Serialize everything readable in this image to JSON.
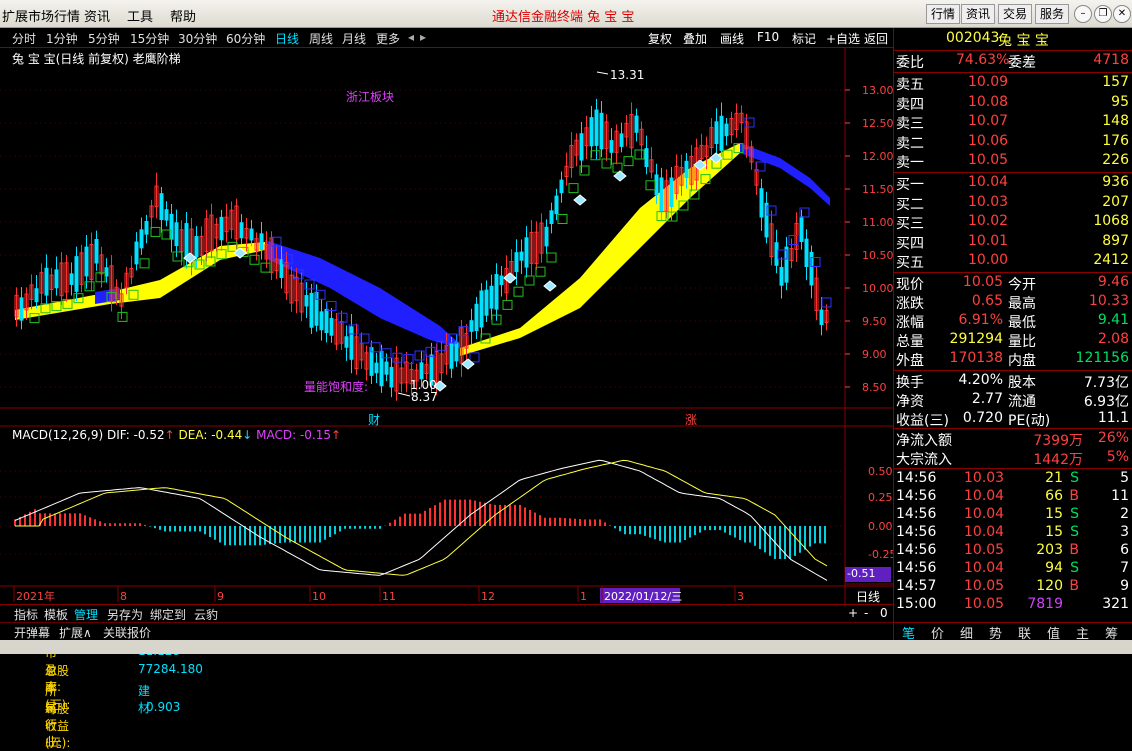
{
  "menu": {
    "items": [
      "扩展市场行情",
      "资讯",
      "工具",
      "帮助"
    ],
    "app_title": "通达信金融终端  兔 宝 宝",
    "right_buttons": [
      "行情",
      "资讯",
      "交易",
      "服务"
    ]
  },
  "timeframes": [
    "分时",
    "1分钟",
    "5分钟",
    "15分钟",
    "30分钟",
    "60分钟",
    "日线",
    "周线",
    "月线",
    "更多"
  ],
  "active_timeframe": "日线",
  "tools": [
    "复权",
    "叠加",
    "画线",
    "F10",
    "标记",
    "+自选",
    "返回"
  ],
  "chart": {
    "title": "兔 宝 宝(日线 前复权) 老鹰阶梯",
    "info": [
      {
        "label": "市盈率:",
        "value": "11.128"
      },
      {
        "label": "总股本(万):",
        "value": "77284.180"
      },
      {
        "label": "所属行业:",
        "value": "建材"
      },
      {
        "label": "每股收益(元):",
        "value": "0.903"
      }
    ],
    "sector": "浙江板块",
    "volume_label": "量能饱和度:",
    "volume_value": "1.00",
    "high_label": "13.31",
    "low_label": "8.37",
    "price_axis": [
      "13.00",
      "12.50",
      "12.00",
      "11.50",
      "11.00",
      "10.50",
      "10.00",
      "9.50",
      "9.00",
      "8.50"
    ],
    "markers": [
      "财",
      "涨"
    ],
    "macd_label": "MACD(12,26,9)",
    "dif": "DIF: -0.52",
    "dea": "DEA: -0.44",
    "macd": "MACD: -0.15",
    "macd_axis": [
      "0.50",
      "0.25",
      "0.00",
      "-0.25",
      "-0.50"
    ],
    "macd_current": "-0.51",
    "date_labels": [
      "2021年",
      "8",
      "9",
      "10",
      "11",
      "12",
      "1",
      "2022/01/12/三",
      "3"
    ],
    "period": "日线"
  },
  "bottom_tabs": [
    "指标",
    "模板",
    "管理",
    "另存为",
    "绑定到",
    "云豹"
  ],
  "active_bottom_tab": "管理",
  "status_items": [
    "开弹幕",
    "扩展∧",
    "关联报价"
  ],
  "quote": {
    "code": "002043",
    "name": "兔 宝 宝",
    "ratio_label": "委比",
    "ratio": "74.63%",
    "diff_label": "委差",
    "diff": "4718",
    "asks": [
      {
        "label": "卖五",
        "price": "10.09",
        "vol": "157"
      },
      {
        "label": "卖四",
        "price": "10.08",
        "vol": "95"
      },
      {
        "label": "卖三",
        "price": "10.07",
        "vol": "148"
      },
      {
        "label": "卖二",
        "price": "10.06",
        "vol": "176"
      },
      {
        "label": "卖一",
        "price": "10.05",
        "vol": "226"
      }
    ],
    "bids": [
      {
        "label": "买一",
        "price": "10.04",
        "vol": "936"
      },
      {
        "label": "买二",
        "price": "10.03",
        "vol": "207"
      },
      {
        "label": "买三",
        "price": "10.02",
        "vol": "1068"
      },
      {
        "label": "买四",
        "price": "10.01",
        "vol": "897"
      },
      {
        "label": "买五",
        "price": "10.00",
        "vol": "2412"
      }
    ],
    "stats": [
      [
        "现价",
        "10.05",
        "今开",
        "9.46"
      ],
      [
        "涨跌",
        "0.65",
        "最高",
        "10.33"
      ],
      [
        "涨幅",
        "6.91%",
        "最低",
        "9.41"
      ],
      [
        "总量",
        "291294",
        "量比",
        "2.08"
      ],
      [
        "外盘",
        "170138",
        "内盘",
        "121156"
      ]
    ],
    "stats2": [
      [
        "换手",
        "4.20%",
        "股本",
        "7.73亿"
      ],
      [
        "净资",
        "2.77",
        "流通",
        "6.93亿"
      ],
      [
        "收益(三)",
        "0.720",
        "PE(动)",
        "11.1"
      ]
    ],
    "flow": [
      [
        "净流入额",
        "7399万",
        "26%"
      ],
      [
        "大宗流入",
        "1442万",
        "5%"
      ]
    ],
    "ticks": [
      [
        "14:56",
        "10.03",
        "21",
        "S",
        "5"
      ],
      [
        "14:56",
        "10.04",
        "66",
        "B",
        "11"
      ],
      [
        "14:56",
        "10.04",
        "15",
        "S",
        "2"
      ],
      [
        "14:56",
        "10.04",
        "15",
        "S",
        "3"
      ],
      [
        "14:56",
        "10.05",
        "203",
        "B",
        "6"
      ],
      [
        "14:56",
        "10.04",
        "94",
        "S",
        "7"
      ],
      [
        "14:57",
        "10.05",
        "120",
        "B",
        "9"
      ],
      [
        "15:00",
        "10.05",
        "7819",
        "",
        "321"
      ]
    ],
    "tabs": [
      "笔",
      "价",
      "细",
      "势",
      "联",
      "值",
      "主",
      "筹"
    ]
  }
}
